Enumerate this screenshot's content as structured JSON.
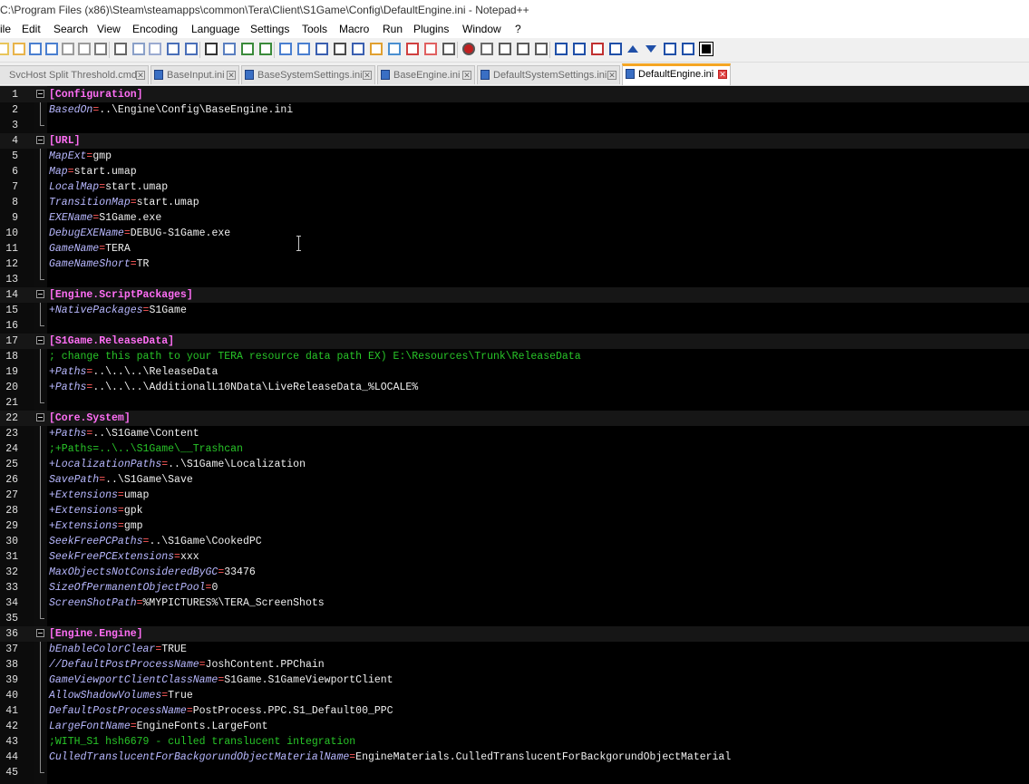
{
  "window": {
    "title": "C:\\Program Files (x86)\\Steam\\steamapps\\common\\Tera\\Client\\S1Game\\Config\\DefaultEngine.ini - Notepad++"
  },
  "menu": [
    "ile",
    "Edit",
    "Search",
    "View",
    "Encoding",
    "Language",
    "Settings",
    "Tools",
    "Macro",
    "Run",
    "Plugins",
    "Window",
    "?"
  ],
  "toolbar": {
    "icons": [
      "new-file-icon",
      "open-file-icon",
      "save-icon",
      "save-all-icon",
      "close-icon",
      "close-all-icon",
      "print-icon",
      "cut-icon",
      "copy-icon",
      "paste-icon",
      "undo-icon",
      "redo-icon",
      "find-icon",
      "replace-icon",
      "zoom-in-icon",
      "zoom-out-icon",
      "sync-vertical-icon",
      "sync-horizontal-icon",
      "word-wrap-icon",
      "show-all-chars-icon",
      "indent-guide-icon",
      "user-language-icon",
      "document-map-icon",
      "function-list-icon",
      "folder-workspace-icon",
      "monitoring-icon",
      "record-macro-icon",
      "stop-macro-icon",
      "play-macro-icon",
      "run-macro-multiple-icon",
      "save-macro-icon",
      "plugin-1-icon",
      "plugin-2-icon",
      "plugin-3-icon",
      "plugin-4-icon",
      "move-up-icon",
      "move-down-icon",
      "plugin-5-icon",
      "plugin-6-icon",
      "dark-mode-icon"
    ]
  },
  "tabs": [
    {
      "label": "SvcHost Split Threshold.cmd",
      "active": false
    },
    {
      "label": "BaseInput.ini",
      "active": false
    },
    {
      "label": "BaseSystemSettings.ini",
      "active": false
    },
    {
      "label": "BaseEngine.ini",
      "active": false
    },
    {
      "label": "DefaultSystemSettings.ini",
      "active": false
    },
    {
      "label": "DefaultEngine.ini",
      "active": true
    }
  ],
  "colors": {
    "section": "#ff6ef5",
    "key": "#b8b8ff",
    "operator": "#ff5a5a",
    "value": "#f0f0f0",
    "comment": "#28c528",
    "editor_bg": "#000000",
    "active_tab_accent": "#f5a623"
  },
  "lines": [
    {
      "n": "1",
      "type": "section",
      "text": "[Configuration]"
    },
    {
      "n": "2",
      "type": "kv",
      "key": "BasedOn",
      "value": "..\\Engine\\Config\\BaseEngine.ini"
    },
    {
      "n": "3",
      "type": "blank"
    },
    {
      "n": "4",
      "type": "section",
      "text": "[URL]"
    },
    {
      "n": "5",
      "type": "kv",
      "key": "MapExt",
      "value": "gmp"
    },
    {
      "n": "6",
      "type": "kv",
      "key": "Map",
      "value": "start.umap"
    },
    {
      "n": "7",
      "type": "kv",
      "key": "LocalMap",
      "value": "start.umap"
    },
    {
      "n": "8",
      "type": "kv",
      "key": "TransitionMap",
      "value": "start.umap"
    },
    {
      "n": "9",
      "type": "kv",
      "key": "EXEName",
      "value": "S1Game.exe"
    },
    {
      "n": "10",
      "type": "kv",
      "key": "DebugEXEName",
      "value": "DEBUG-S1Game.exe"
    },
    {
      "n": "11",
      "type": "kv",
      "key": "GameName",
      "value": "TERA"
    },
    {
      "n": "12",
      "type": "kv",
      "key": "GameNameShort",
      "value": "TR"
    },
    {
      "n": "13",
      "type": "blank"
    },
    {
      "n": "14",
      "type": "section",
      "text": "[Engine.ScriptPackages]"
    },
    {
      "n": "15",
      "type": "kv",
      "key": "+NativePackages",
      "value": "S1Game"
    },
    {
      "n": "16",
      "type": "blank"
    },
    {
      "n": "17",
      "type": "section",
      "text": "[S1Game.ReleaseData]"
    },
    {
      "n": "18",
      "type": "comment",
      "text": "; change this path to your TERA resource data path EX) E:\\Resources\\Trunk\\ReleaseData"
    },
    {
      "n": "19",
      "type": "kv",
      "key": "+Paths",
      "value": "..\\..\\..\\ReleaseData"
    },
    {
      "n": "20",
      "type": "kv",
      "key": "+Paths",
      "value": "..\\..\\..\\AdditionalL10NData\\LiveReleaseData_%LOCALE%"
    },
    {
      "n": "21",
      "type": "blank"
    },
    {
      "n": "22",
      "type": "section",
      "text": "[Core.System]"
    },
    {
      "n": "23",
      "type": "kv",
      "key": "+Paths",
      "value": "..\\S1Game\\Content"
    },
    {
      "n": "24",
      "type": "comment",
      "text": ";+Paths=..\\..\\S1Game\\__Trashcan"
    },
    {
      "n": "25",
      "type": "kv",
      "key": "+LocalizationPaths",
      "value": "..\\S1Game\\Localization"
    },
    {
      "n": "26",
      "type": "kv",
      "key": "SavePath",
      "value": "..\\S1Game\\Save"
    },
    {
      "n": "27",
      "type": "kv",
      "key": "+Extensions",
      "value": "umap"
    },
    {
      "n": "28",
      "type": "kv",
      "key": "+Extensions",
      "value": "gpk"
    },
    {
      "n": "29",
      "type": "kv",
      "key": "+Extensions",
      "value": "gmp"
    },
    {
      "n": "30",
      "type": "kv",
      "key": "SeekFreePCPaths",
      "value": "..\\S1Game\\CookedPC"
    },
    {
      "n": "31",
      "type": "kv",
      "key": "SeekFreePCExtensions",
      "value": "xxx"
    },
    {
      "n": "32",
      "type": "kv",
      "key": "MaxObjectsNotConsideredByGC",
      "value": "33476"
    },
    {
      "n": "33",
      "type": "kv",
      "key": "SizeOfPermanentObjectPool",
      "value": "0"
    },
    {
      "n": "34",
      "type": "kv",
      "key": "ScreenShotPath",
      "value": "%MYPICTURES%\\TERA_ScreenShots"
    },
    {
      "n": "35",
      "type": "blank"
    },
    {
      "n": "36",
      "type": "section",
      "text": "[Engine.Engine]"
    },
    {
      "n": "37",
      "type": "kv",
      "key": "bEnableColorClear",
      "value": "TRUE"
    },
    {
      "n": "38",
      "type": "kv",
      "key": "//DefaultPostProcessName",
      "value": "JoshContent.PPChain"
    },
    {
      "n": "39",
      "type": "kv",
      "key": "GameViewportClientClassName",
      "value": "S1Game.S1GameViewportClient"
    },
    {
      "n": "40",
      "type": "kv",
      "key": "AllowShadowVolumes",
      "value": "True"
    },
    {
      "n": "41",
      "type": "kv",
      "key": "DefaultPostProcessName",
      "value": "PostProcess.PPC.S1_Default00_PPC"
    },
    {
      "n": "42",
      "type": "kv",
      "key": "LargeFontName",
      "value": "EngineFonts.LargeFont"
    },
    {
      "n": "43",
      "type": "comment",
      "text": ";WITH_S1 hsh6679 - culled translucent integration"
    },
    {
      "n": "44",
      "type": "kv",
      "key": "CulledTranslucentForBackgorundObjectMaterialName",
      "value": "EngineMaterials.CulledTranslucentForBackgorundObjectMaterial"
    },
    {
      "n": "45",
      "type": "blank"
    }
  ]
}
